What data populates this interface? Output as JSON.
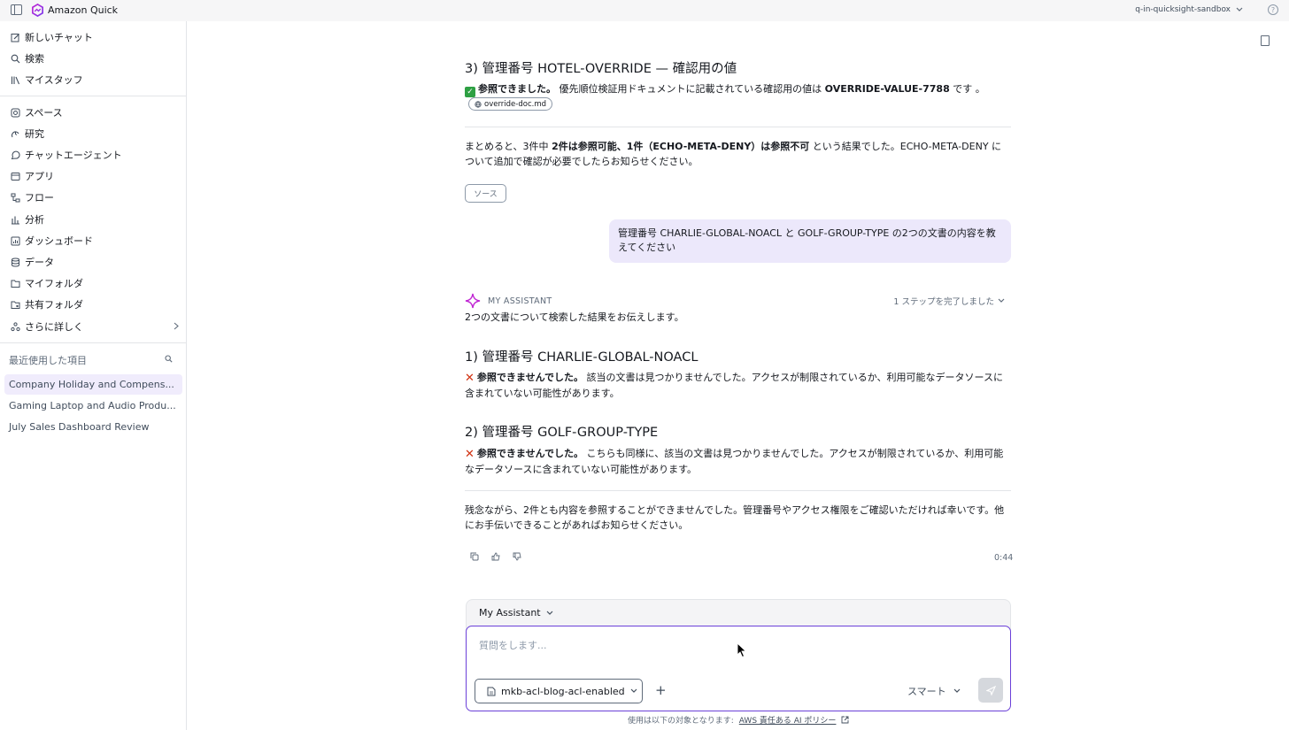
{
  "topbar": {
    "app_name": "Amazon Quick",
    "account": "q-in-quicksight-sandbox",
    "help": "?"
  },
  "sidebar": {
    "top_items": [
      {
        "label": "新しいチャット",
        "icon": "edit-icon"
      },
      {
        "label": "検索",
        "icon": "search-icon"
      },
      {
        "label": "マイスタッフ",
        "icon": "library-icon"
      }
    ],
    "main_items": [
      {
        "label": "スペース",
        "icon": "spaces-icon"
      },
      {
        "label": "研究",
        "icon": "research-icon"
      },
      {
        "label": "チャットエージェント",
        "icon": "chat-agent-icon"
      },
      {
        "label": "アプリ",
        "icon": "apps-icon"
      },
      {
        "label": "フロー",
        "icon": "flow-icon"
      },
      {
        "label": "分析",
        "icon": "analysis-icon"
      },
      {
        "label": "ダッシュボード",
        "icon": "dashboard-icon"
      },
      {
        "label": "データ",
        "icon": "database-icon"
      },
      {
        "label": "マイフォルダ",
        "icon": "folder-icon"
      },
      {
        "label": "共有フォルダ",
        "icon": "shared-folder-icon"
      },
      {
        "label": "さらに詳しく",
        "icon": "more-icon"
      }
    ],
    "recent_label": "最近使用した項目",
    "recent_items": [
      {
        "label": "Company Holiday and Compens...",
        "active": true
      },
      {
        "label": "Gaming Laptop and Audio Produ...",
        "active": false
      },
      {
        "label": "July Sales Dashboard Review",
        "active": false
      }
    ]
  },
  "conversation": {
    "prev": {
      "heading3": "3) 管理番号 HOTEL-OVERRIDE — 確認用の値",
      "result3_bold": "参照できました。",
      "result3_text_a": " 優先順位検証用ドキュメントに記載されている確認用の値は ",
      "result3_value": "OVERRIDE-VALUE-7788",
      "result3_text_b": " です 。",
      "chip": "override-doc.md",
      "summary_a": "まとめると、3件中 ",
      "summary_bold": "2件は参照可能、1件（ECHO-META-DENY）は参照不可",
      "summary_b": " という結果でした。ECHO-META-DENY について追加で確認が必要でしたらお知らせください。",
      "source_button": "ソース"
    },
    "user_message": "管理番号 CHARLIE-GLOBAL-NOACL と GOLF-GROUP-TYPE の2つの文書の内容を教えてください",
    "assistant": {
      "name": "MY ASSISTANT",
      "steps": "1 ステップを完了しました",
      "intro": "2つの文書について検索した結果をお伝えします。",
      "heading1": "1) 管理番号 CHARLIE-GLOBAL-NOACL",
      "result1_bold": "参照できませんでした。",
      "result1_text": " 該当の文書は見つかりませんでした。アクセスが制限されているか、利用可能なデータソースに含まれていない可能性があります。",
      "heading2": "2) 管理番号 GOLF-GROUP-TYPE",
      "result2_bold": "参照できませんでした。",
      "result2_text": " こちらも同様に、該当の文書は見つかりませんでした。アクセスが制限されているか、利用可能なデータソースに含まれていない可能性があります。",
      "closing": "残念ながら、2件とも内容を参照することができませんでした。管理番号やアクセス権限をご確認いただければ幸いです。他にお手伝いできることがあればお知らせください。",
      "time": "0:44"
    }
  },
  "composer": {
    "agent": "My Assistant",
    "placeholder": "質問をします...",
    "knowledge_base": "mkb-acl-blog-acl-enabled",
    "mode": "スマート"
  },
  "footer": {
    "text": "使用は以下の対象となります:",
    "link": "AWS 責任ある AI ポリシー"
  }
}
